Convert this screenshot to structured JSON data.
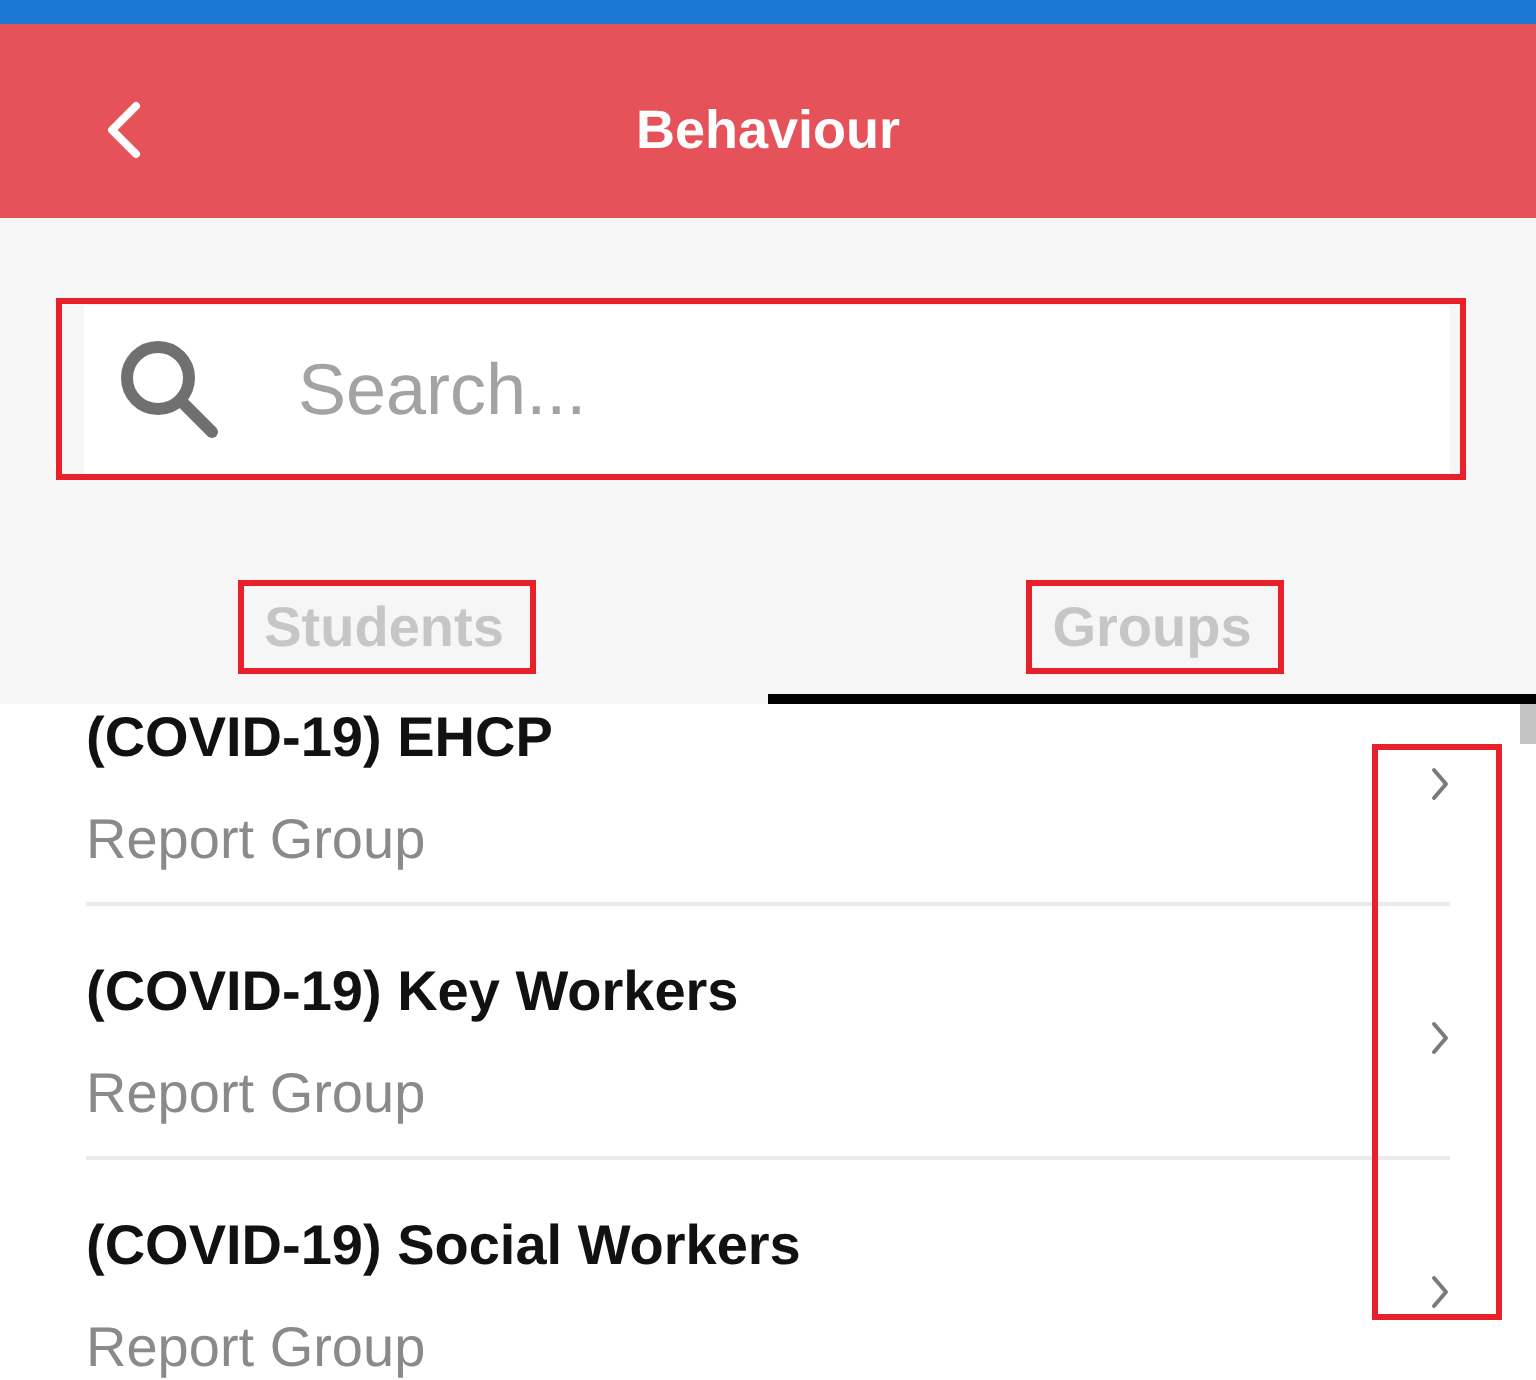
{
  "header": {
    "title": "Behaviour"
  },
  "search": {
    "placeholder": "Search...",
    "highlighted": true
  },
  "tabs": [
    {
      "label": "Students",
      "selected": false,
      "highlighted": true
    },
    {
      "label": "Groups",
      "selected": true,
      "highlighted": true
    }
  ],
  "list": {
    "chevrons_highlighted": true,
    "rows": [
      {
        "title": "(COVID-19) EHCP",
        "subtitle": "Report Group"
      },
      {
        "title": "(COVID-19) Key Workers",
        "subtitle": "Report Group"
      },
      {
        "title": "(COVID-19) Social Workers",
        "subtitle": "Report Group"
      }
    ]
  }
}
